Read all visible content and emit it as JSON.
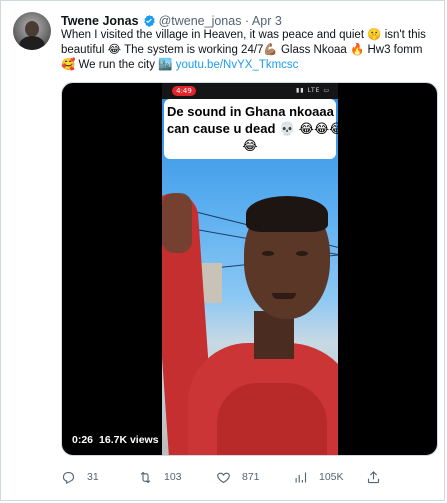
{
  "tweet": {
    "author_name": "Twene Jonas",
    "handle": "@twene_jonas",
    "separator": "·",
    "date": "Apr 3",
    "text_line1": "When I visited the village in Heaven, it was peace and quiet 🤫 isn't this",
    "text_line2": "beautiful 😂 The system is working 24/7💪🏽 Glass Nkoaa 🔥 Hw3 fomm",
    "text_line3_prefix": "🥰 We run the city 🏙️",
    "link": "youtu.be/NvYX_Tkmcsc"
  },
  "video": {
    "status_time": "4:49",
    "status_icons": "▮▮ LTE ▭",
    "caption_line1": "De sound in Ghana nkoaaa",
    "caption_line2": "can cause u dead 💀 😂😂😂",
    "caption_line3": "😂",
    "duration": "0:26",
    "views": "16.7K views"
  },
  "actions": {
    "replies": "31",
    "retweets": "103",
    "likes": "871",
    "views": "105K"
  },
  "colors": {
    "accent": "#1d9bf0",
    "muted": "#536471",
    "border": "#cfd9de"
  }
}
